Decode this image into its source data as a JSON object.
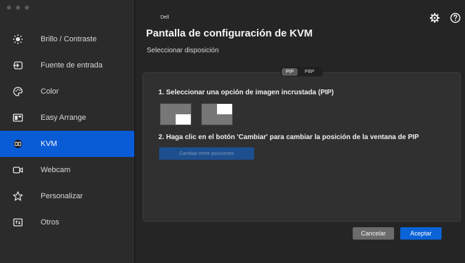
{
  "colors": {
    "accent": "#0a5bd6",
    "sidebar": "#2b2b2b",
    "panel": "#303030"
  },
  "window_controls": [
    "close-dot",
    "minimize-dot",
    "zoom-dot"
  ],
  "sidebar": {
    "items": [
      {
        "label": "Brillo / Contraste",
        "icon": "sun-icon"
      },
      {
        "label": "Fuente de entrada",
        "icon": "input-source-icon"
      },
      {
        "label": "Color",
        "icon": "color-palette-icon"
      },
      {
        "label": "Easy Arrange",
        "icon": "layout-icon"
      },
      {
        "label": "KVM",
        "icon": "kvm-icon",
        "active": true
      },
      {
        "label": "Webcam",
        "icon": "webcam-icon"
      },
      {
        "label": "Personalizar",
        "icon": "star-icon"
      },
      {
        "label": "Otros",
        "icon": "others-icon"
      }
    ]
  },
  "header": {
    "brand": "Dell",
    "title": "Pantalla de configuración de KVM",
    "subtitle": "Seleccionar disposición"
  },
  "toggle": {
    "pip": "PIP",
    "pbp": "PBP",
    "selected": "PIP"
  },
  "steps": {
    "one": "1. Seleccionar una opción de imagen incrustada (PIP)",
    "two": "2. Haga clic en el botón 'Cambiar' para cambiar la posición de la ventana de PIP"
  },
  "swap_button": "Cambiar entre posiciones",
  "footer": {
    "cancel": "Cancelar",
    "accept": "Aceptar"
  }
}
